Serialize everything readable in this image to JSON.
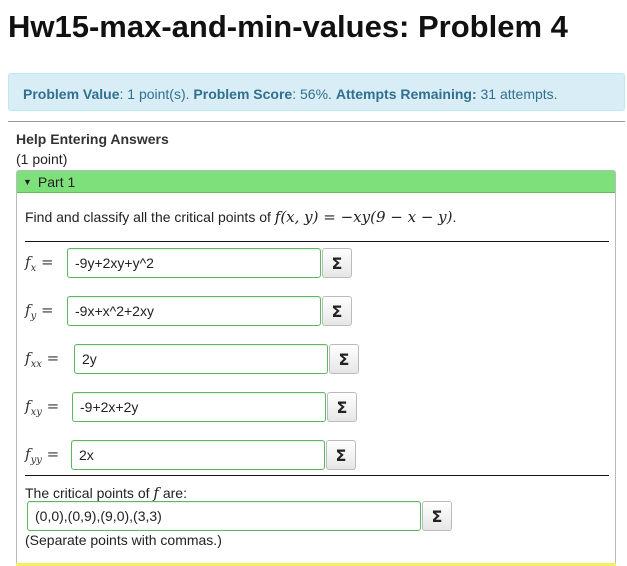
{
  "page": {
    "title": "Hw15-max-and-min-values: Problem 4"
  },
  "info": {
    "value_label": "Problem Value",
    "value_text": ": 1 point(s). ",
    "score_label": "Problem Score",
    "score_text": ": 56%. ",
    "attempts_label": "Attempts Remaining:",
    "attempts_text": " 31 attempts."
  },
  "help": {
    "link": "Help Entering Answers",
    "points": "(1 point)"
  },
  "part": {
    "header": "Part 1",
    "prompt_text": "Find and classify all the critical points of ",
    "prompt_math": "f(x, y) = −xy(9 − x − y)",
    "prompt_end": ".",
    "rows": [
      {
        "label": "f",
        "sub": "x",
        "value": "-9y+2xy+y^2"
      },
      {
        "label": "f",
        "sub": "y",
        "value": "-9x+x^2+2xy"
      },
      {
        "label": "f",
        "sub": "xx",
        "value": "2y"
      },
      {
        "label": "f",
        "sub": "xy",
        "value": "-9+2x+2y"
      },
      {
        "label": "f",
        "sub": "yy",
        "value": "2x"
      }
    ],
    "eq_sign": "=",
    "cp_label_pre": "The critical points of ",
    "cp_label_f": "f",
    "cp_label_post": " are:",
    "cp_value": "(0,0),(0,9),(9,0),(3,3)",
    "note": "(Separate points with commas.)",
    "sigma": "Σ"
  }
}
